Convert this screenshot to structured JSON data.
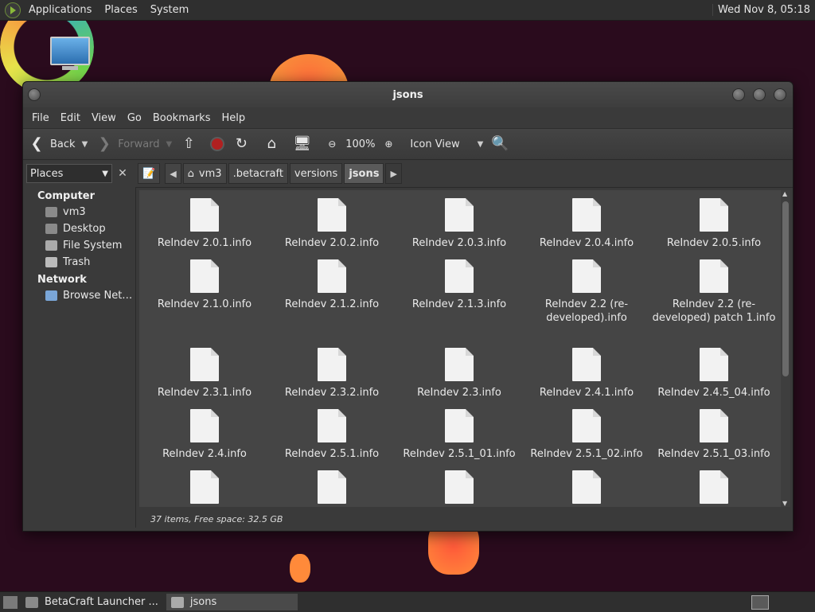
{
  "top_panel": {
    "menus": [
      "Applications",
      "Places",
      "System"
    ],
    "clock": "Wed Nov  8, 05:18"
  },
  "window": {
    "title": "jsons",
    "menubar": [
      "File",
      "Edit",
      "View",
      "Go",
      "Bookmarks",
      "Help"
    ],
    "toolbar": {
      "back": "Back",
      "forward": "Forward",
      "zoom": "100%",
      "view_mode": "Icon View"
    },
    "places_select": "Places",
    "breadcrumbs": [
      "vm3",
      ".betacraft",
      "versions",
      "jsons"
    ],
    "sidebar": {
      "computer_heading": "Computer",
      "computer_items": [
        "vm3",
        "Desktop",
        "File System",
        "Trash"
      ],
      "network_heading": "Network",
      "network_items": [
        "Browse Net…"
      ]
    },
    "files": [
      "ReIndev 2.0.1.info",
      "ReIndev 2.0.2.info",
      "ReIndev 2.0.3.info",
      "ReIndev 2.0.4.info",
      "ReIndev 2.0.5.info",
      "ReIndev 2.1.0.info",
      "ReIndev 2.1.2.info",
      "ReIndev 2.1.3.info",
      "ReIndev 2.2 (re-developed).info",
      "ReIndev 2.2 (re-developed) patch 1.info",
      "ReIndev 2.3.1.info",
      "ReIndev 2.3.2.info",
      "ReIndev 2.3.info",
      "ReIndev 2.4.1.info",
      "ReIndev 2.4.5_04.info",
      "ReIndev 2.4.info",
      "ReIndev 2.5.1.info",
      "ReIndev 2.5.1_01.info",
      "ReIndev 2.5.1_02.info",
      "ReIndev 2.5.1_03.info",
      "",
      "",
      "",
      "",
      ""
    ],
    "status": "37 items, Free space: 32.5 GB"
  },
  "bottom_panel": {
    "tasks": [
      "BetaCraft Launcher ...",
      "jsons"
    ]
  }
}
